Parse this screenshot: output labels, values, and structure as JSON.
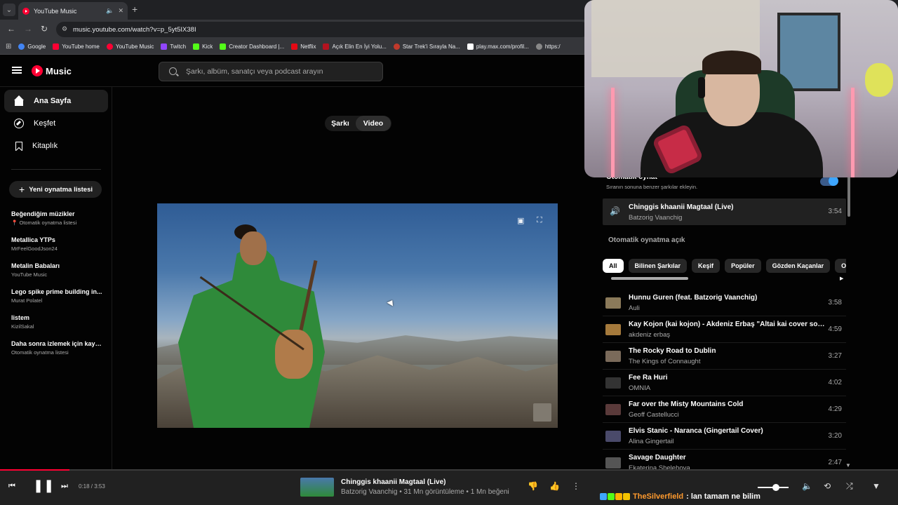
{
  "browser": {
    "tab_title": "YouTube Music",
    "url": "music.youtube.com/watch?v=p_5yt5IX38I",
    "bookmarks": [
      "Google",
      "YouTube home",
      "YouTube Music",
      "Twitch",
      "Kick",
      "Creator Dashboard |...",
      "Netflix",
      "Açık Elin En İyi Yolu...",
      "Star Trek'i Sırayla Na...",
      "play.max.com/profil...",
      "https:/"
    ]
  },
  "header": {
    "logo_text": "Music",
    "search_placeholder": "Şarkı, albüm, sanatçı veya podcast arayın"
  },
  "sidebar": {
    "nav": [
      "Ana Sayfa",
      "Keşfet",
      "Kitaplık"
    ],
    "new_playlist": "Yeni oynatma listesi",
    "playlists": [
      {
        "title": "Beğendiğim müzikler",
        "sub": "Otomatik oynatma listesi"
      },
      {
        "title": "Metallica YTPs",
        "sub": "MrFeelGoodJson24"
      },
      {
        "title": "Metalin Babaları",
        "sub": "YouTube Music"
      },
      {
        "title": "Lego spike prime building in...",
        "sub": "Murat Polatel"
      },
      {
        "title": "listem",
        "sub": "KizilSakal"
      },
      {
        "title": "Daha sonra izlemek için kayd...",
        "sub": "Otomatik oynatma listesi"
      }
    ]
  },
  "toggle": {
    "song": "Şarkı",
    "video": "Video"
  },
  "queue": {
    "autoplay_title": "Otomatik oynat",
    "autoplay_sub": "Sıranın sonuna benzer şarkılar ekleyin.",
    "current": {
      "title": "Chinggis khaanii Magtaal (Live)",
      "artist": "Batzorig Vaanchig",
      "duration": "3:54"
    },
    "section_label": "Otomatik oynatma açık",
    "chips": [
      "All",
      "Bilinen Şarkılar",
      "Keşif",
      "Popüler",
      "Gözden Kaçanlar",
      "Odakl"
    ],
    "items": [
      {
        "title": "Hunnu Guren (feat. Batzorig Vaanchig)",
        "artist": "Auli",
        "duration": "3:58"
      },
      {
        "title": "Kay Kojon (kai kojon) - Akdeniz Erbaş \"Altai kai cover son...",
        "artist": "akdeniz erbaş",
        "duration": "4:59"
      },
      {
        "title": "The Rocky Road to Dublin",
        "artist": "The Kings of Connaught",
        "duration": "3:27"
      },
      {
        "title": "Fee Ra Huri",
        "artist": "OMNIA",
        "duration": "4:02"
      },
      {
        "title": "Far over the Misty Mountains Cold",
        "artist": "Geoff Castellucci",
        "duration": "4:29"
      },
      {
        "title": "Elvis Stanic - Naranca (Gingertail Cover)",
        "artist": "Alina Gingertail",
        "duration": "3:20"
      },
      {
        "title": "Savage Daughter",
        "artist": "Ekaterina Shelehova",
        "duration": "2:47"
      }
    ]
  },
  "player": {
    "time": "0:18 / 3:53",
    "progress": 0.077,
    "title": "Chinggis khaanii Magtaal (Live)",
    "subtitle": "Batzorig Vaanchig • 31 Mn görüntüleme • 1 Mn beğeni"
  },
  "chat": {
    "user": "TheSilverfield",
    "message": ": lan tamam ne bilim"
  },
  "colors": {
    "accent": "#ff0033",
    "toggle_blue": "#3ea6ff"
  }
}
